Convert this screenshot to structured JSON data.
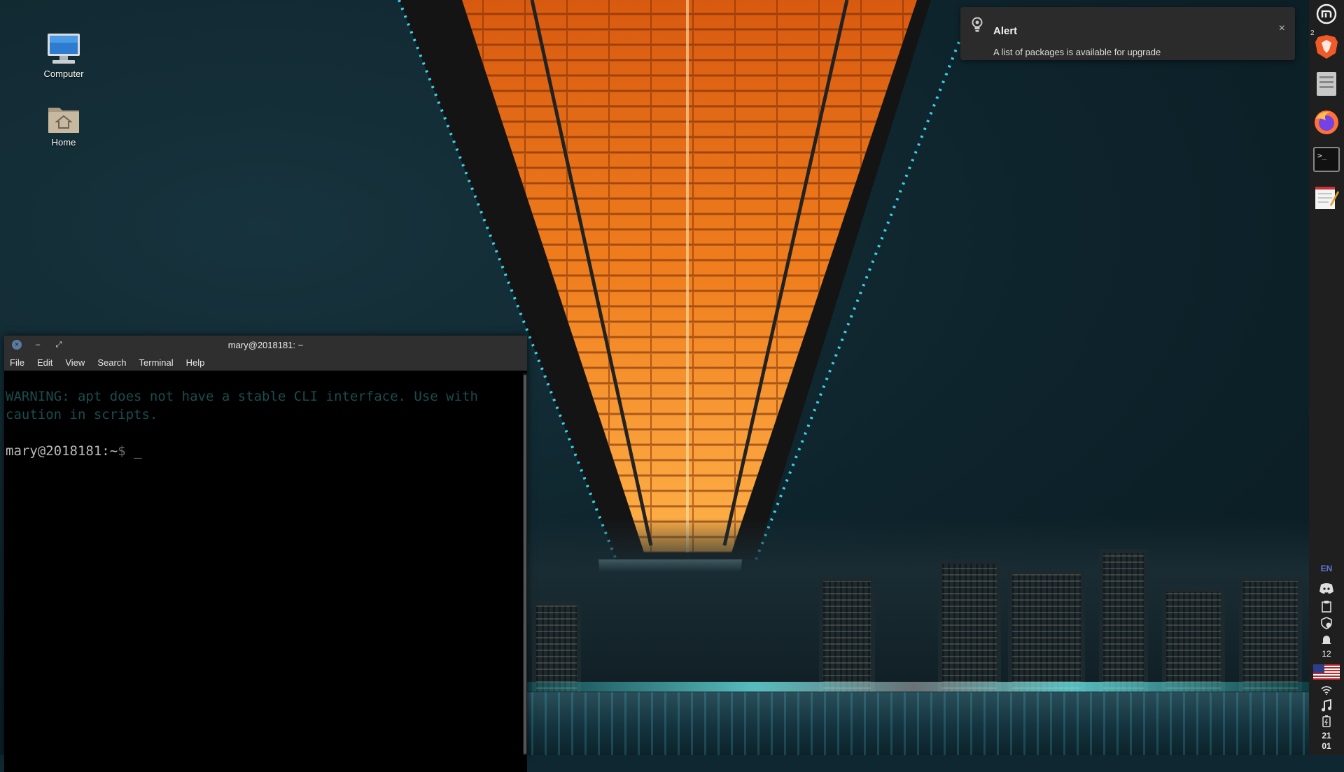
{
  "desktop": {
    "icons": [
      {
        "label": "Computer"
      },
      {
        "label": "Home"
      }
    ]
  },
  "notification": {
    "title": "Alert",
    "body": "A list of packages is available for upgrade",
    "close_label": "×",
    "icon": "lightbulb-icon"
  },
  "terminal": {
    "title": "mary@2018181: ~",
    "window_controls": {
      "close": "×",
      "minimize": "–",
      "maximize": "⤢"
    },
    "menu": [
      "File",
      "Edit",
      "View",
      "Search",
      "Terminal",
      "Help"
    ],
    "output_warning": "WARNING: apt does not have a stable CLI interface. Use with caution in scripts.",
    "prompt_user": "mary@2018181",
    "prompt_path": ":~",
    "prompt_symbol": "$",
    "cursor": "_"
  },
  "panel": {
    "launchers": [
      {
        "name": "mint-menu-icon"
      },
      {
        "name": "brave-browser-icon",
        "badge": "2"
      },
      {
        "name": "file-manager-icon"
      },
      {
        "name": "firefox-icon"
      },
      {
        "name": "terminal-icon"
      },
      {
        "name": "text-editor-icon"
      }
    ],
    "tray": {
      "keyboard_layout": "EN",
      "notifications_count": "12",
      "icons": [
        "discord-icon",
        "clipboard-icon",
        "shield-update-icon",
        "notification-bell-icon",
        "us-flag-icon",
        "wifi-icon",
        "music-icon",
        "battery-icon"
      ]
    },
    "clock_hour": "21",
    "clock_minute": "01"
  },
  "colors": {
    "accent_blue": "#5c7ad6",
    "terminal_bg": "#000000",
    "warning_text": "#1a4d4f",
    "panel_bg": "#1f1f1f"
  }
}
